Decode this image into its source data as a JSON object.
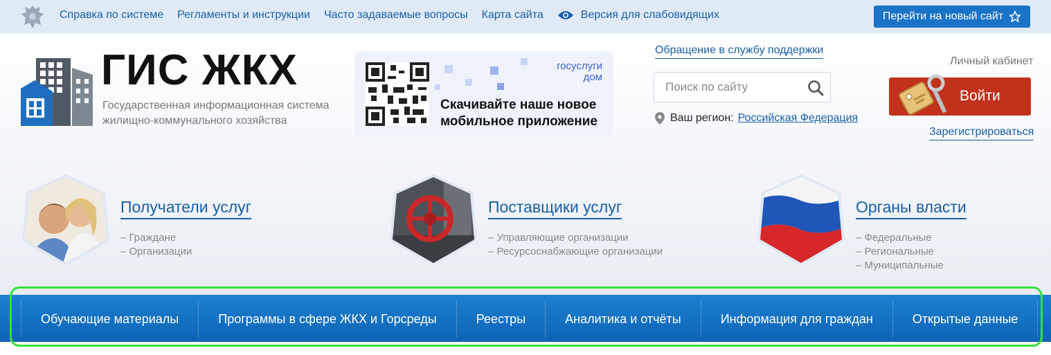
{
  "topbar": {
    "links": [
      "Справка по системе",
      "Регламенты и инструкции",
      "Часто задаваемые вопросы",
      "Карта сайта"
    ],
    "low_vision_label": "Версия для слабовидящих",
    "new_site_label": "Перейти на новый сайт"
  },
  "logo": {
    "title": "ГИС ЖКХ",
    "subtitle": "Государственная информационная система жилищно-коммунального хозяйства"
  },
  "promo": {
    "brand_line1": "госуслуги",
    "brand_line2": "дом",
    "text_line1": "Скачивайте наше новое",
    "text_line2": "мобильное приложение"
  },
  "support": {
    "link": "Обращение в службу поддержки"
  },
  "search": {
    "placeholder": "Поиск по сайту",
    "value": ""
  },
  "region": {
    "label": "Ваш регион:",
    "value": "Российская Федерация"
  },
  "account": {
    "cabinet_label": "Личный кабинет",
    "login_label": "Войти",
    "register_label": "Зарегистрироваться"
  },
  "categories": [
    {
      "title": "Получатели услуг",
      "items": [
        "– Граждане",
        "– Организации"
      ]
    },
    {
      "title": "Поставщики услуг",
      "items": [
        "– Управляющие организации",
        "– Ресурсоснабжающие организации"
      ]
    },
    {
      "title": "Органы власти",
      "items": [
        "– Федеральные",
        "– Региональные",
        "– Муниципальные"
      ]
    }
  ],
  "nav": [
    "Обучающие материалы",
    "Программы в сфере ЖКХ и Горсреды",
    "Реестры",
    "Аналитика и отчёты",
    "Информация для граждан",
    "Открытые данные"
  ],
  "colors": {
    "accent": "#1a73c7",
    "link": "#1a5fa8",
    "login": "#c0321c",
    "nav": "#1473c4",
    "highlight": "#35e03a"
  }
}
